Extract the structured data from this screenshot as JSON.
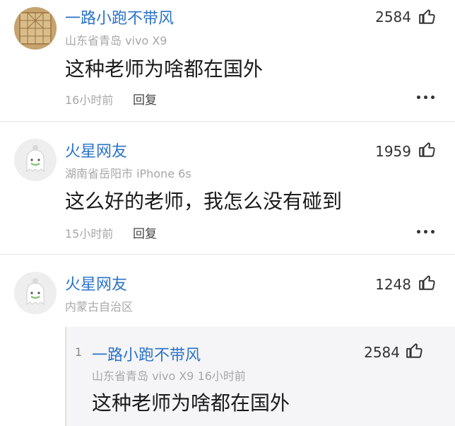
{
  "comments": [
    {
      "username": "一路小跑不带风",
      "meta": "山东省青岛  vivo X9",
      "text": "这种老师为啥都在国外",
      "time": "16小时前",
      "reply_label": "回复",
      "likes": "2584",
      "avatar": "chess-board-avatar"
    },
    {
      "username": "火星网友",
      "meta": "湖南省岳阳市  iPhone 6s",
      "text": "这么好的老师，我怎么没有碰到",
      "time": "15小时前",
      "reply_label": "回复",
      "likes": "1959",
      "avatar": "mars-ghost-avatar"
    },
    {
      "username": "火星网友",
      "meta": "内蒙古自治区",
      "likes": "1248",
      "avatar": "mars-ghost-avatar",
      "quoted": {
        "index": "1",
        "username": "一路小跑不带风",
        "meta": "山东省青岛  vivo X9  16小时前",
        "text": "这种老师为啥都在国外",
        "likes": "2584"
      }
    }
  ],
  "icons": {
    "like": "thumbs-up-icon",
    "more": "more-dots-icon"
  },
  "colors": {
    "username": "#2a73c9",
    "meta": "#a7a7a7",
    "text": "#1a1a1a"
  }
}
